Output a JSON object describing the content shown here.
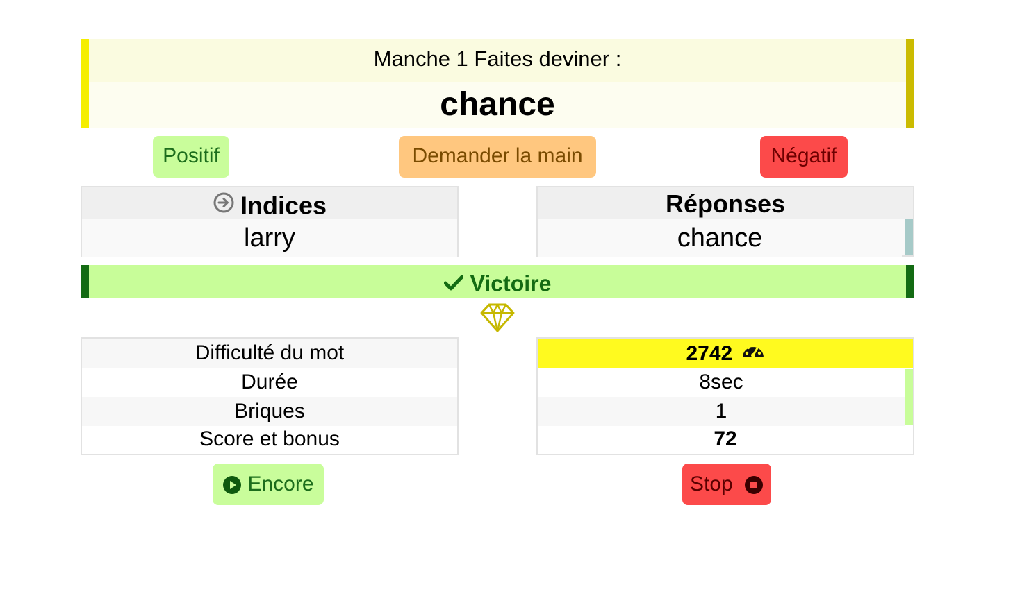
{
  "header": {
    "round_line": "Manche 1 Faites deviner :",
    "word": "chance"
  },
  "actions": {
    "positive": "Positif",
    "ask_hand": "Demander la main",
    "negative": "Négatif"
  },
  "clues": {
    "title": "Indices",
    "items": [
      "larry"
    ]
  },
  "answers": {
    "title": "Réponses",
    "items": [
      "chance"
    ]
  },
  "result": {
    "label": "Victoire"
  },
  "stats": {
    "labels": [
      "Difficulté du mot",
      "Durée",
      "Briques",
      "Score et bonus"
    ],
    "values": [
      "2742",
      "8sec",
      "1",
      "72"
    ]
  },
  "footer": {
    "again": "Encore",
    "stop": "Stop"
  },
  "colors": {
    "banner_left": "#f5ee00",
    "banner_right": "#cbbb00",
    "positive": "#c9fd9b",
    "ask": "#ffc77f",
    "negative": "#fc4a4a",
    "victory": "#c8fd99",
    "victory_accent": "#136b13",
    "difficulty_highlight": "#fffa1f"
  }
}
